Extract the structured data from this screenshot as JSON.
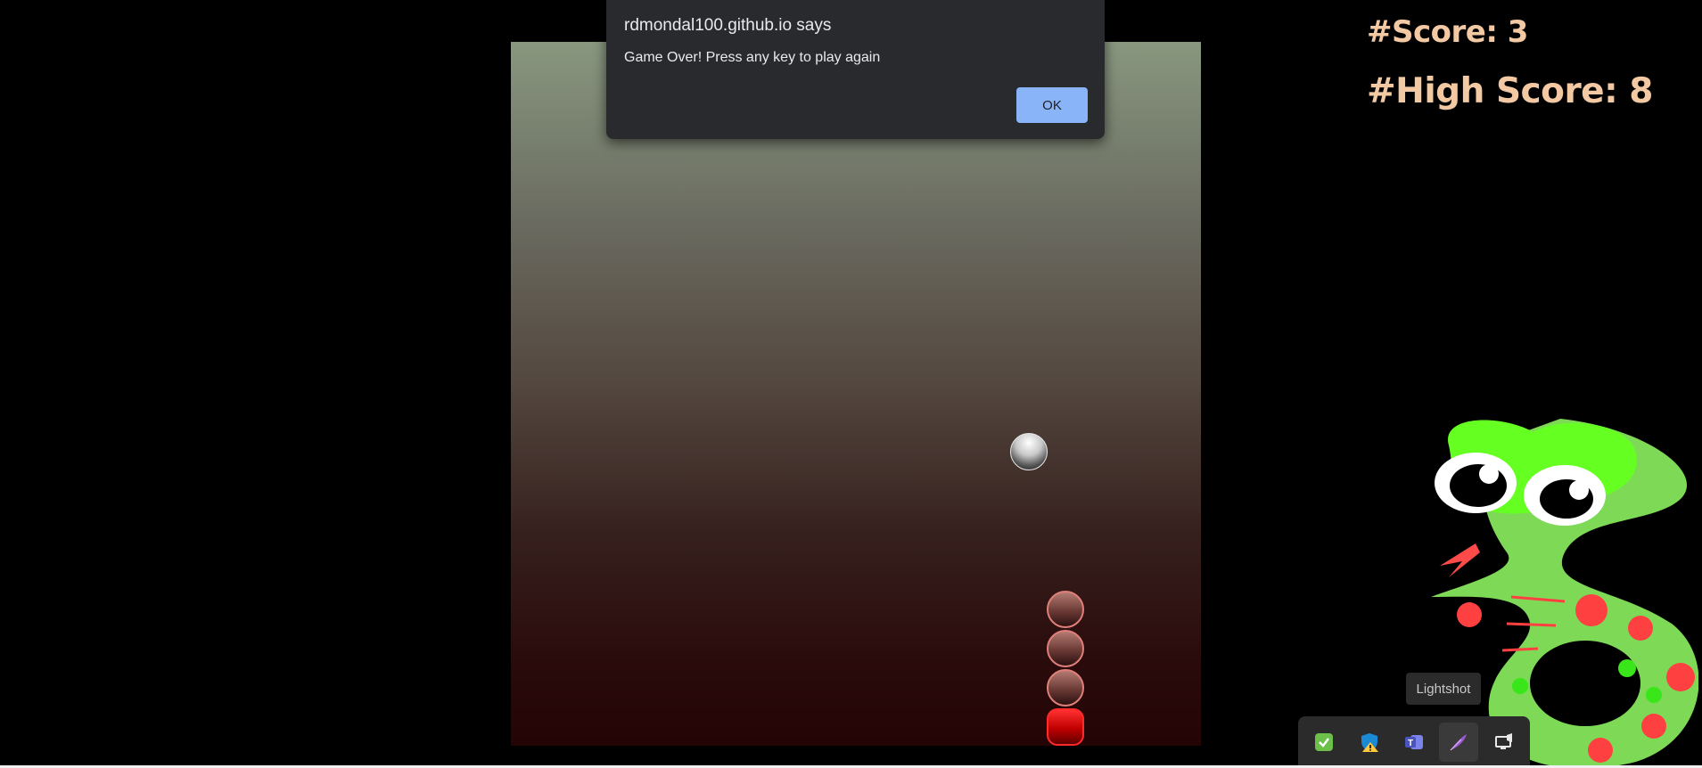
{
  "dialog": {
    "title": "rdmondal100.github.io says",
    "message": "Game Over! Press any key to play again",
    "ok_label": "OK"
  },
  "scoreboard": {
    "score_text": "#Score: 3",
    "high_score_text": "#High Score: 8"
  },
  "game": {
    "snake_length": 4,
    "food_count": 1
  },
  "taskbar": {
    "tooltip": "Lightshot",
    "tray_icons": [
      "security-check-icon",
      "defender-warning-icon",
      "teams-icon",
      "lightshot-feather-icon",
      "monitor-speaker-icon"
    ]
  },
  "colors": {
    "score_text": "#f3c9a3",
    "ok_button": "#8ab4f8",
    "snake_head": "#ff2a2a",
    "mascot_green": "#66ff22"
  }
}
